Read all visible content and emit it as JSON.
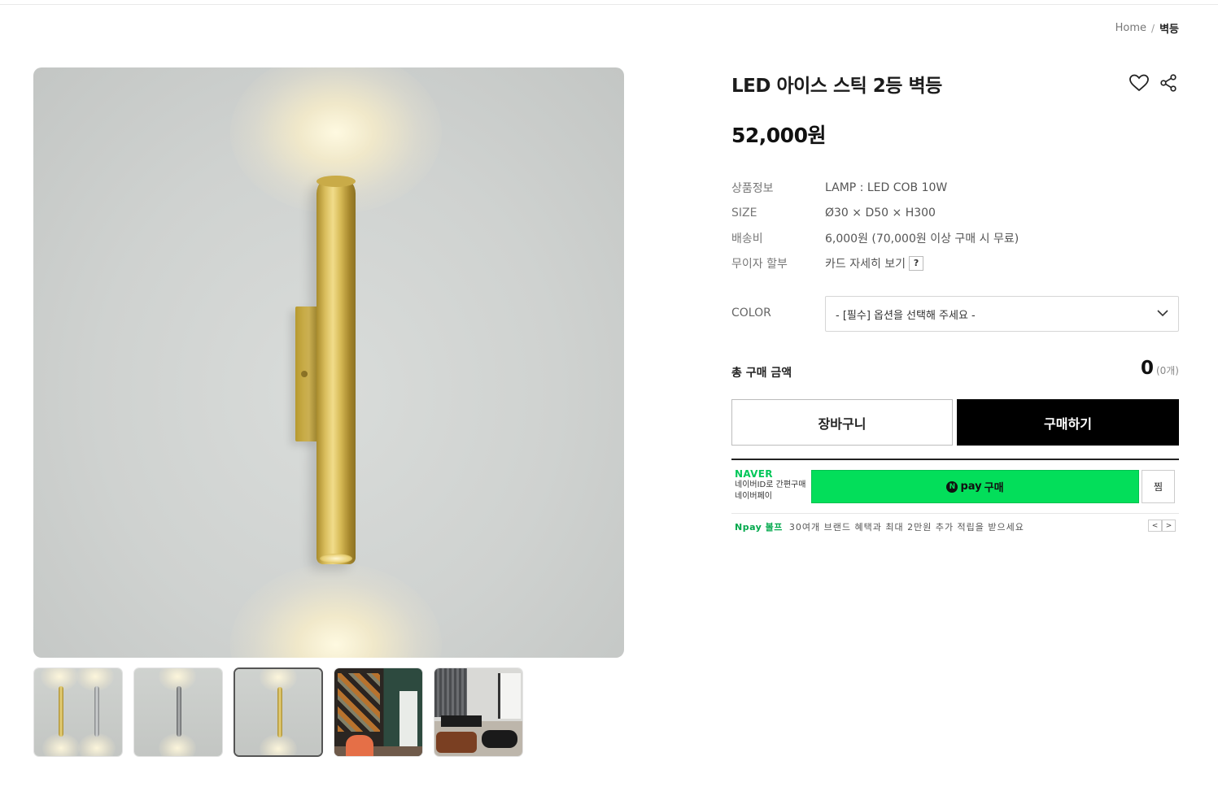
{
  "breadcrumb": {
    "home": "Home",
    "separator": "/",
    "current": "벽등"
  },
  "product": {
    "title": "LED 아이스 스틱 2등 벽등",
    "price": "52,000원"
  },
  "info": [
    {
      "key": "상품정보",
      "value": "LAMP : LED COB 10W"
    },
    {
      "key": "SIZE",
      "value": "Ø30 × D50 × H300"
    },
    {
      "key": "배송비",
      "value": "6,000원 (70,000원 이상 구매 시 무료)"
    },
    {
      "key": "무이자 할부",
      "value": "카드 자세히 보기",
      "badge": "?"
    }
  ],
  "option": {
    "label": "COLOR",
    "selected": "- [필수] 옵션을 선택해 주세요 -"
  },
  "total": {
    "label": "총 구매 금액",
    "amount": "0",
    "count": "(0개)"
  },
  "buttons": {
    "cart": "장바구니",
    "buy": "구매하기"
  },
  "npay": {
    "brand": "NAVER",
    "sub1": "네이버ID로 간편구매",
    "sub2": "네이버페이",
    "n": "N",
    "pay": "pay",
    "buy": "구매",
    "jjim": "찜",
    "promo_brand": "Npay 볼프",
    "promo_text": "30여개 브랜드 혜택과 최대 2만원 추가 적립을 받으세요",
    "prev": "<",
    "next": ">"
  },
  "icons": {
    "heart": "heart-icon",
    "share": "share-icon",
    "dropdown": "chevron-down-icon"
  },
  "colors": {
    "accent_buy": "#000000",
    "npay_green": "#03de5a",
    "naver_green": "#03c75a"
  }
}
